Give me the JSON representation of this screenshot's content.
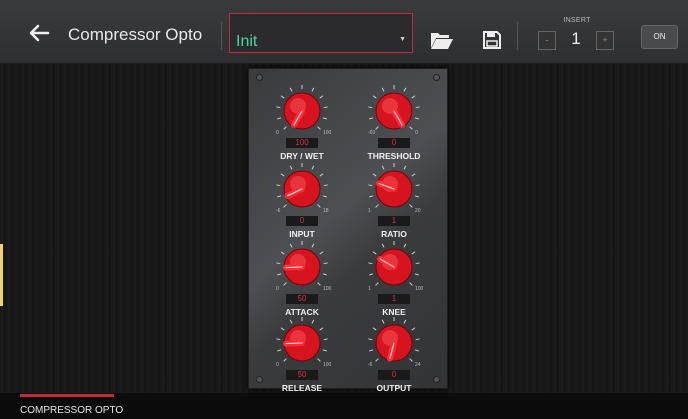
{
  "header": {
    "title": "Compressor Opto",
    "preset_label": "",
    "preset_value": "Init",
    "insert_label": "INSERT",
    "insert_number": "1",
    "insert_prev": "-",
    "insert_next": "+",
    "on_label": "ON"
  },
  "icons": {
    "back": "arrow-left-icon",
    "folder": "folder-open-icon",
    "save": "floppy-disk-icon",
    "caret": "caret-down-icon"
  },
  "colors": {
    "accent": "#c4283a",
    "preset_text": "#4fd3a0",
    "knob_red": "#d6141f",
    "value_text": "#d23248",
    "side_tab": "#f2d36b"
  },
  "knobs": [
    {
      "name": "dry-wet",
      "label": "DRY / WET",
      "value": "100",
      "min": "0",
      "max": "100"
    },
    {
      "name": "threshold",
      "label": "THRESHOLD",
      "value": "0",
      "min": "-60",
      "max": "0"
    },
    {
      "name": "input",
      "label": "INPUT",
      "value": "0",
      "min": "-6",
      "max": "18"
    },
    {
      "name": "ratio",
      "label": "RATIO",
      "value": "1",
      "min": "1",
      "max": "20"
    },
    {
      "name": "attack",
      "label": "ATTACK",
      "value": "50",
      "min": "0",
      "max": "100"
    },
    {
      "name": "knee",
      "label": "KNEE",
      "value": "1",
      "min": "1",
      "max": "100"
    },
    {
      "name": "release",
      "label": "RELEASE",
      "value": "50",
      "min": "0",
      "max": "100"
    },
    {
      "name": "output",
      "label": "OUTPUT",
      "value": "0",
      "min": "-6",
      "max": "24"
    }
  ],
  "footer": {
    "tab_label": "COMPRESSOR OPTO"
  }
}
